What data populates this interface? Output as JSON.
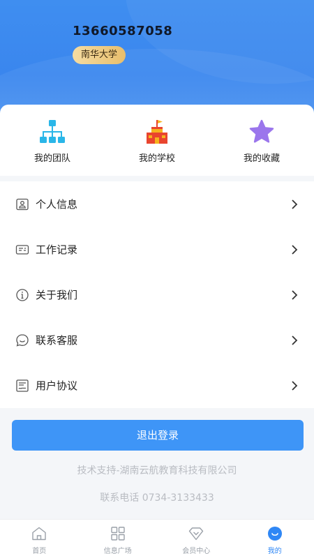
{
  "profile": {
    "phone": "13660587058",
    "school": "南华大学"
  },
  "quick_actions": [
    {
      "label": "我的团队",
      "icon": "team-icon"
    },
    {
      "label": "我的学校",
      "icon": "school-icon"
    },
    {
      "label": "我的收藏",
      "icon": "star-icon"
    }
  ],
  "menu": [
    {
      "label": "个人信息",
      "icon": "id-card-icon"
    },
    {
      "label": "工作记录",
      "icon": "record-icon"
    },
    {
      "label": "关于我们",
      "icon": "info-icon"
    },
    {
      "label": "联系客服",
      "icon": "chat-icon"
    },
    {
      "label": "用户协议",
      "icon": "agreement-icon"
    }
  ],
  "logout_label": "退出登录",
  "footer": {
    "support": "技术支持-湖南云航教育科技有限公司",
    "tel": "联系电话 0734-3133433"
  },
  "tabs": [
    {
      "label": "首页",
      "icon": "home-icon"
    },
    {
      "label": "信息广场",
      "icon": "grid-icon"
    },
    {
      "label": "会员中心",
      "icon": "diamond-icon"
    },
    {
      "label": "我的",
      "icon": "profile-icon",
      "active": true
    }
  ],
  "colors": {
    "header": "#3a86ee",
    "accent": "#3e95f7",
    "badge": "#e8be6c"
  }
}
